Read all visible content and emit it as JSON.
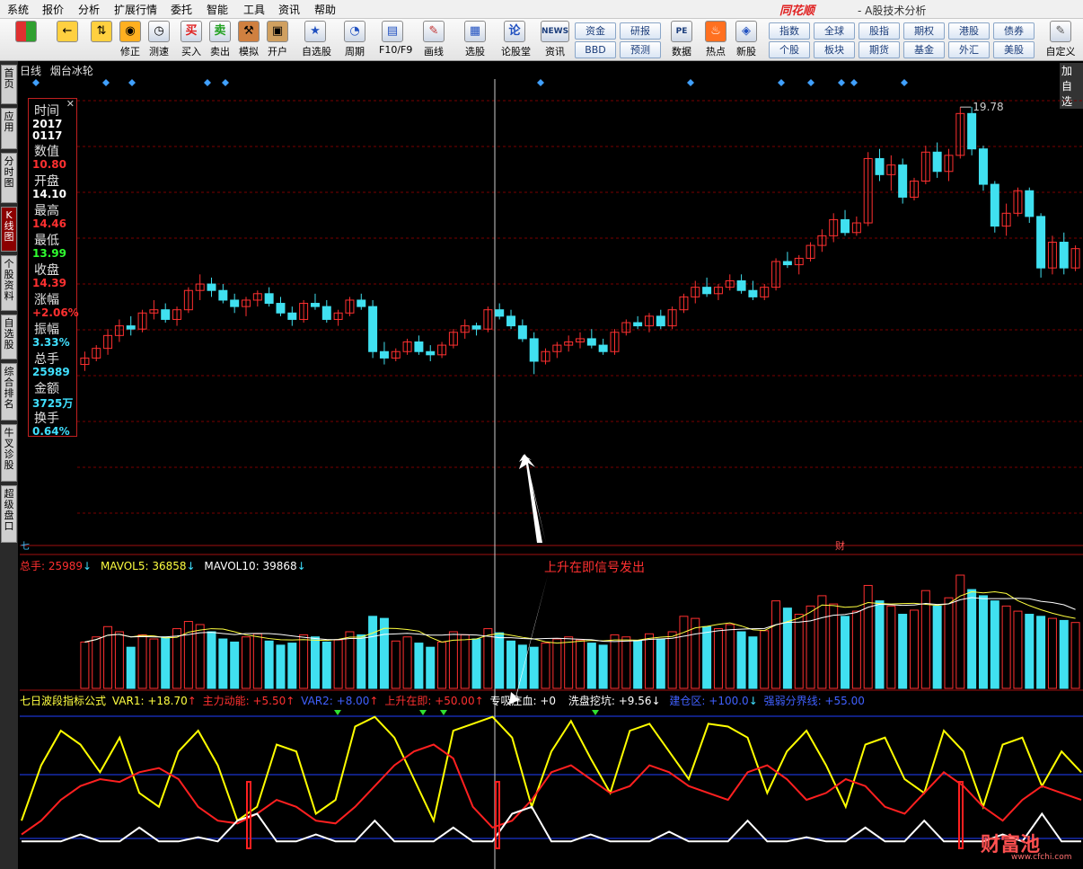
{
  "menu": [
    "系统",
    "报价",
    "分析",
    "扩展行情",
    "委托",
    "智能",
    "工具",
    "资讯",
    "帮助"
  ],
  "brand": "同花顺",
  "app_title": "- A股技术分析",
  "toolbar": {
    "buttons": [
      {
        "label": "",
        "icon": "home-grid-icon"
      },
      {
        "label": "",
        "icon": "back-arrow-icon"
      },
      {
        "label": "",
        "icon": "up-down-arrow-icon"
      },
      {
        "label": "修正",
        "icon": "coin-icon"
      },
      {
        "label": "测速",
        "icon": "clock-icon"
      },
      {
        "label": "买入",
        "icon": "buy-icon",
        "text": "买"
      },
      {
        "label": "卖出",
        "icon": "sell-icon",
        "text": "卖"
      },
      {
        "label": "模拟",
        "icon": "hammer-icon"
      },
      {
        "label": "开户",
        "icon": "lock-icon"
      },
      {
        "label": "自选股",
        "icon": "star-icon"
      },
      {
        "label": "周期",
        "icon": "cycle-icon"
      },
      {
        "label": "F10/F9",
        "icon": "f10-icon"
      },
      {
        "label": "画线",
        "icon": "pen-icon"
      },
      {
        "label": "选股",
        "icon": "monitor-icon"
      },
      {
        "label": "论股堂",
        "icon": "forum-icon"
      },
      {
        "label": "资讯",
        "icon": "news-icon",
        "text": "NEWS"
      },
      {
        "label": "数据",
        "icon": "pe-icon",
        "text": "PE"
      },
      {
        "label": "热点",
        "icon": "hot-icon"
      },
      {
        "label": "新股",
        "icon": "new-stock-icon"
      },
      {
        "label": "自定义",
        "icon": "custom-icon"
      }
    ],
    "quick": [
      "资金",
      "BBD",
      "研报",
      "预测",
      "指数",
      "个股",
      "全球",
      "板块",
      "股指",
      "期货",
      "期权",
      "基金",
      "港股",
      "外汇",
      "债券",
      "美股"
    ]
  },
  "sidebar": [
    "首页",
    "应用",
    "分时图",
    "K线图",
    "个股资料",
    "自选股",
    "综合排名",
    "牛叉诊股",
    "超级盘口"
  ],
  "chart": {
    "period": "日线",
    "stock_name": "烟台冰轮",
    "add_to_watch": "加自选",
    "high_marker": "19.78",
    "fin_marker": "财",
    "bottom_marker": "七"
  },
  "info": {
    "labels": [
      "时间",
      "数值",
      "开盘",
      "最高",
      "最低",
      "收盘",
      "涨幅",
      "振幅",
      "总手",
      "金额",
      "换手"
    ],
    "time_year": "2017",
    "time_md": "0117",
    "values": {
      "数值": "10.80",
      "开盘": "14.10",
      "最高": "14.46",
      "最低": "13.99",
      "收盘": "14.39",
      "涨幅": "+2.06%",
      "振幅": "3.33%",
      "总手": "25989",
      "金额": "3725万",
      "换手": "0.64%"
    },
    "colors": {
      "数值": "#ff3030",
      "开盘": "#ffffff",
      "最高": "#ff3030",
      "最低": "#30ff30",
      "收盘": "#ff3030",
      "涨幅": "#ff3030",
      "振幅": "#40e0ff",
      "总手": "#40e0ff",
      "金额": "#40e0ff",
      "换手": "#40e0ff"
    }
  },
  "volume_header": {
    "total": "总手: 25989",
    "mavol5": "MAVOL5: 36858",
    "mavol10": "MAVOL10: 39868"
  },
  "indicator_header": {
    "name": "七日波段指标公式",
    "items": [
      "VAR1: +18.70",
      "主力动能: +5.50",
      "VAR2: +8.00",
      "上升在即: +50.00",
      "专吸庄血: +0",
      "洗盘挖坑: +9.56",
      "建仓区: +100.0",
      "强弱分界线: +55.00"
    ]
  },
  "annotation": "上升在即信号发出",
  "watermark": {
    "text": "财富池",
    "url": "www.cfchi.com"
  },
  "colors": {
    "up": "#ff3030",
    "down": "#40e0f0",
    "grid": "#7a0000",
    "ma5": "#ffff40",
    "ma10": "#ffffff",
    "diamond": "#40a0ff",
    "ind_yellow": "#ffff00",
    "ind_red": "#ff2020",
    "ind_white": "#ffffff",
    "ind_blue": "#2040ff",
    "signal": "#30e030"
  },
  "chart_data": {
    "type": "candlestick",
    "price_range": [
      10.0,
      20.0
    ],
    "candles": [
      [
        11.8,
        12.2,
        11.6,
        12.0
      ],
      [
        12.0,
        12.4,
        11.9,
        12.3
      ],
      [
        12.3,
        12.9,
        12.1,
        12.7
      ],
      [
        12.7,
        13.2,
        12.5,
        13.0
      ],
      [
        13.0,
        13.3,
        12.7,
        12.9
      ],
      [
        12.9,
        13.5,
        12.8,
        13.4
      ],
      [
        13.4,
        13.8,
        13.2,
        13.5
      ],
      [
        13.5,
        13.7,
        13.1,
        13.2
      ],
      [
        13.2,
        13.6,
        13.0,
        13.5
      ],
      [
        13.5,
        14.2,
        13.4,
        14.1
      ],
      [
        14.1,
        14.6,
        13.8,
        14.3
      ],
      [
        14.3,
        14.5,
        13.9,
        14.1
      ],
      [
        14.1,
        14.3,
        13.7,
        13.8
      ],
      [
        13.8,
        14.0,
        13.4,
        13.6
      ],
      [
        13.6,
        13.9,
        13.3,
        13.8
      ],
      [
        13.8,
        14.1,
        13.6,
        14.0
      ],
      [
        14.0,
        14.2,
        13.6,
        13.7
      ],
      [
        13.7,
        13.9,
        13.3,
        13.4
      ],
      [
        13.4,
        13.6,
        13.0,
        13.2
      ],
      [
        13.2,
        13.8,
        13.1,
        13.7
      ],
      [
        13.7,
        14.0,
        13.5,
        13.6
      ],
      [
        13.6,
        13.8,
        13.1,
        13.2
      ],
      [
        13.2,
        13.5,
        13.0,
        13.4
      ],
      [
        13.4,
        13.9,
        13.3,
        13.8
      ],
      [
        13.8,
        14.0,
        13.5,
        13.6
      ],
      [
        13.6,
        13.8,
        12.0,
        12.2
      ],
      [
        12.2,
        12.5,
        11.8,
        12.0
      ],
      [
        12.0,
        12.3,
        11.9,
        12.2
      ],
      [
        12.2,
        12.6,
        12.1,
        12.5
      ],
      [
        12.5,
        12.7,
        12.1,
        12.2
      ],
      [
        12.2,
        12.4,
        11.9,
        12.1
      ],
      [
        12.1,
        12.5,
        12.0,
        12.4
      ],
      [
        12.4,
        12.9,
        12.3,
        12.8
      ],
      [
        12.8,
        13.2,
        12.6,
        13.0
      ],
      [
        13.0,
        13.1,
        12.7,
        12.9
      ],
      [
        12.9,
        13.6,
        12.8,
        13.5
      ],
      [
        13.5,
        13.7,
        13.2,
        13.3
      ],
      [
        13.3,
        13.5,
        12.9,
        13.0
      ],
      [
        13.0,
        13.2,
        12.5,
        12.6
      ],
      [
        12.6,
        12.8,
        11.5,
        11.9
      ],
      [
        11.9,
        12.3,
        11.8,
        12.2
      ],
      [
        12.2,
        12.5,
        12.0,
        12.4
      ],
      [
        12.4,
        12.7,
        12.2,
        12.5
      ],
      [
        12.5,
        12.8,
        12.3,
        12.6
      ],
      [
        12.6,
        12.9,
        12.3,
        12.4
      ],
      [
        12.4,
        12.6,
        12.1,
        12.2
      ],
      [
        12.2,
        12.9,
        12.1,
        12.8
      ],
      [
        12.8,
        13.2,
        12.7,
        13.1
      ],
      [
        13.1,
        13.3,
        12.9,
        13.0
      ],
      [
        13.0,
        13.4,
        12.8,
        13.3
      ],
      [
        13.3,
        13.5,
        12.9,
        13.0
      ],
      [
        13.0,
        13.6,
        12.9,
        13.5
      ],
      [
        13.5,
        14.0,
        13.4,
        13.9
      ],
      [
        13.9,
        14.4,
        13.7,
        14.2
      ],
      [
        14.2,
        14.5,
        13.9,
        14.0
      ],
      [
        14.0,
        14.3,
        13.8,
        14.2
      ],
      [
        14.2,
        14.6,
        14.1,
        14.4
      ],
      [
        14.4,
        14.6,
        14.0,
        14.1
      ],
      [
        14.1,
        14.4,
        13.8,
        13.9
      ],
      [
        13.9,
        14.3,
        13.8,
        14.2
      ],
      [
        14.2,
        15.1,
        14.1,
        15.0
      ],
      [
        15.0,
        15.3,
        14.8,
        14.9
      ],
      [
        14.9,
        15.2,
        14.6,
        15.1
      ],
      [
        15.1,
        15.6,
        15.0,
        15.5
      ],
      [
        15.5,
        16.0,
        15.3,
        15.8
      ],
      [
        15.8,
        16.5,
        15.6,
        16.3
      ],
      [
        16.3,
        16.6,
        15.8,
        15.9
      ],
      [
        15.9,
        16.4,
        15.8,
        16.2
      ],
      [
        16.2,
        18.4,
        16.1,
        18.2
      ],
      [
        18.2,
        18.5,
        17.5,
        17.7
      ],
      [
        17.7,
        18.3,
        17.2,
        18.0
      ],
      [
        18.0,
        18.2,
        16.8,
        17.0
      ],
      [
        17.0,
        17.6,
        16.9,
        17.5
      ],
      [
        17.5,
        18.6,
        17.4,
        18.4
      ],
      [
        18.4,
        18.7,
        17.6,
        17.8
      ],
      [
        17.8,
        18.5,
        17.5,
        18.3
      ],
      [
        18.3,
        19.8,
        18.2,
        19.6
      ],
      [
        19.6,
        19.8,
        18.3,
        18.5
      ],
      [
        18.5,
        18.6,
        17.2,
        17.4
      ],
      [
        17.4,
        17.5,
        15.9,
        16.1
      ],
      [
        16.1,
        16.8,
        15.8,
        16.5
      ],
      [
        16.5,
        17.3,
        16.4,
        17.2
      ],
      [
        17.2,
        17.3,
        16.2,
        16.4
      ],
      [
        16.4,
        16.5,
        14.5,
        14.8
      ],
      [
        14.8,
        15.8,
        14.6,
        15.6
      ],
      [
        15.6,
        15.9,
        14.6,
        14.8
      ],
      [
        14.8,
        15.5,
        14.7,
        15.4
      ]
    ],
    "volumes": [
      45,
      50,
      60,
      55,
      40,
      52,
      48,
      50,
      58,
      65,
      62,
      55,
      48,
      45,
      50,
      53,
      46,
      42,
      44,
      52,
      50,
      45,
      47,
      55,
      52,
      70,
      68,
      46,
      50,
      44,
      40,
      45,
      55,
      52,
      48,
      58,
      54,
      46,
      42,
      40,
      44,
      48,
      50,
      47,
      44,
      42,
      52,
      50,
      46,
      53,
      48,
      55,
      70,
      68,
      60,
      58,
      62,
      55,
      50,
      56,
      85,
      78,
      72,
      80,
      90,
      82,
      70,
      75,
      100,
      85,
      80,
      72,
      76,
      95,
      80,
      88,
      110,
      96,
      90,
      85,
      80,
      75,
      72,
      70,
      68,
      66,
      64
    ],
    "indicator": {
      "yellow": [
        20,
        60,
        85,
        75,
        55,
        80,
        40,
        30,
        70,
        85,
        60,
        20,
        30,
        75,
        70,
        25,
        35,
        88,
        95,
        80,
        50,
        20,
        85,
        90,
        95,
        80,
        30,
        70,
        92,
        65,
        40,
        85,
        90,
        70,
        50,
        90,
        88,
        80,
        40,
        70,
        85,
        60,
        30,
        75,
        80,
        50,
        40,
        85,
        70,
        30,
        75,
        80,
        45,
        70,
        55
      ],
      "red": [
        10,
        20,
        35,
        45,
        50,
        48,
        55,
        58,
        50,
        30,
        20,
        18,
        25,
        35,
        30,
        20,
        18,
        30,
        45,
        60,
        70,
        75,
        65,
        30,
        15,
        20,
        35,
        55,
        60,
        50,
        40,
        45,
        60,
        55,
        45,
        40,
        35,
        55,
        60,
        50,
        35,
        40,
        50,
        45,
        30,
        25,
        40,
        55,
        45,
        30,
        20,
        35,
        45,
        40,
        35
      ],
      "white": [
        5,
        5,
        5,
        10,
        5,
        5,
        15,
        5,
        5,
        8,
        5,
        20,
        25,
        5,
        5,
        10,
        5,
        5,
        20,
        5,
        5,
        5,
        15,
        5,
        5,
        25,
        30,
        5,
        5,
        10,
        5,
        5,
        5,
        12,
        5,
        5,
        5,
        20,
        5,
        5,
        8,
        5,
        5,
        15,
        5,
        5,
        20,
        5,
        5,
        5,
        10,
        5,
        25,
        5,
        5
      ]
    }
  }
}
